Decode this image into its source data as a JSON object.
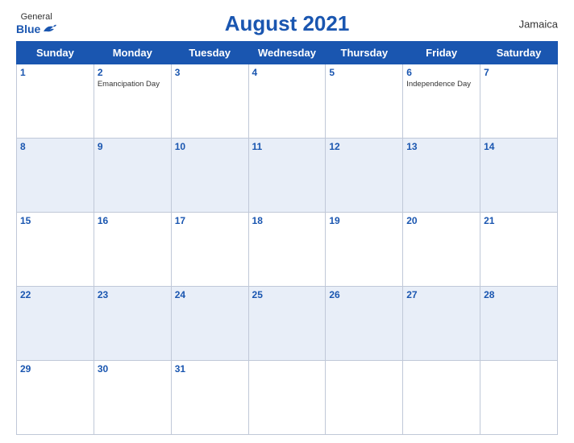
{
  "header": {
    "logo_general": "General",
    "logo_blue": "Blue",
    "title": "August 2021",
    "country": "Jamaica"
  },
  "days_of_week": [
    "Sunday",
    "Monday",
    "Tuesday",
    "Wednesday",
    "Thursday",
    "Friday",
    "Saturday"
  ],
  "weeks": [
    [
      {
        "day": "1",
        "holiday": ""
      },
      {
        "day": "2",
        "holiday": "Emancipation Day"
      },
      {
        "day": "3",
        "holiday": ""
      },
      {
        "day": "4",
        "holiday": ""
      },
      {
        "day": "5",
        "holiday": ""
      },
      {
        "day": "6",
        "holiday": "Independence Day"
      },
      {
        "day": "7",
        "holiday": ""
      }
    ],
    [
      {
        "day": "8",
        "holiday": ""
      },
      {
        "day": "9",
        "holiday": ""
      },
      {
        "day": "10",
        "holiday": ""
      },
      {
        "day": "11",
        "holiday": ""
      },
      {
        "day": "12",
        "holiday": ""
      },
      {
        "day": "13",
        "holiday": ""
      },
      {
        "day": "14",
        "holiday": ""
      }
    ],
    [
      {
        "day": "15",
        "holiday": ""
      },
      {
        "day": "16",
        "holiday": ""
      },
      {
        "day": "17",
        "holiday": ""
      },
      {
        "day": "18",
        "holiday": ""
      },
      {
        "day": "19",
        "holiday": ""
      },
      {
        "day": "20",
        "holiday": ""
      },
      {
        "day": "21",
        "holiday": ""
      }
    ],
    [
      {
        "day": "22",
        "holiday": ""
      },
      {
        "day": "23",
        "holiday": ""
      },
      {
        "day": "24",
        "holiday": ""
      },
      {
        "day": "25",
        "holiday": ""
      },
      {
        "day": "26",
        "holiday": ""
      },
      {
        "day": "27",
        "holiday": ""
      },
      {
        "day": "28",
        "holiday": ""
      }
    ],
    [
      {
        "day": "29",
        "holiday": ""
      },
      {
        "day": "30",
        "holiday": ""
      },
      {
        "day": "31",
        "holiday": ""
      },
      {
        "day": "",
        "holiday": ""
      },
      {
        "day": "",
        "holiday": ""
      },
      {
        "day": "",
        "holiday": ""
      },
      {
        "day": "",
        "holiday": ""
      }
    ]
  ]
}
